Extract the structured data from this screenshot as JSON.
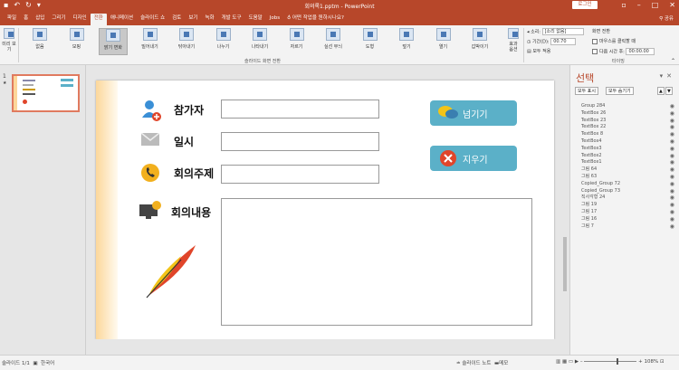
{
  "window": {
    "title": "회의록1.pptm - PowerPoint",
    "login": "로그인",
    "share": "공유"
  },
  "menu": {
    "tabs": [
      "파일",
      "홈",
      "삽입",
      "그리기",
      "디자인",
      "전환",
      "애니메이션",
      "슬라이드 쇼",
      "검토",
      "보기",
      "녹화",
      "개발 도구",
      "도움말",
      "Jobs"
    ],
    "active": "전환",
    "tell_me": "어떤 작업을 원하시나요?"
  },
  "ribbon": {
    "preview": "미리\n보기",
    "preview_sub": "미리 보기",
    "effects": [
      "없음",
      "모핑",
      "밝기 변화",
      "밀어내기",
      "닦아내기",
      "나누기",
      "나타내기",
      "자르기",
      "실선 무늬",
      "도형",
      "덮기",
      "열기",
      "갑박이기"
    ],
    "effect_options": "효과\n옵션",
    "group_label": "슬라이드 화면 전환",
    "timing": {
      "sound_label": "소리:",
      "sound_value": "[소리 없음]",
      "duration_label": "기간(D):",
      "duration_value": "00.70",
      "apply_all": "모두 적용",
      "advance_title": "화면 전환",
      "on_click": "마우스를 클릭할 때",
      "after": "다음 시간 후:",
      "after_value": "00:00.00",
      "group_label": "타이밍"
    }
  },
  "thumbs": {
    "number": "1",
    "star": "★"
  },
  "slide": {
    "participants": "참가자",
    "datetime": "일시",
    "topic": "회의주제",
    "content": "회의내용",
    "next_button": "넘기기",
    "clear_button": "지우기"
  },
  "selection_pane": {
    "title": "선택",
    "show_all": "모두 표시",
    "hide_all": "모두 숨기기",
    "items": [
      "Group 284",
      "TextBox 26",
      "TextBox 23",
      "TextBox 22",
      "TextBox 8",
      "TextBox4",
      "TextBox3",
      "TextBox2",
      "TextBox1",
      "그림 64",
      "그림 63",
      "Copied_Group 72",
      "Copied_Group 73",
      "직사각형 24",
      "그림 19",
      "그림 17",
      "그림 16",
      "그림 7"
    ]
  },
  "status": {
    "slide_info": "슬라이드 1/1",
    "language": "한국어",
    "notes": "슬라이드 노트",
    "comments": "메모",
    "zoom": "108%"
  },
  "colors": {
    "accent": "#b7472a",
    "pill": "#5bb0c8",
    "stripe": "#fcd79a"
  }
}
